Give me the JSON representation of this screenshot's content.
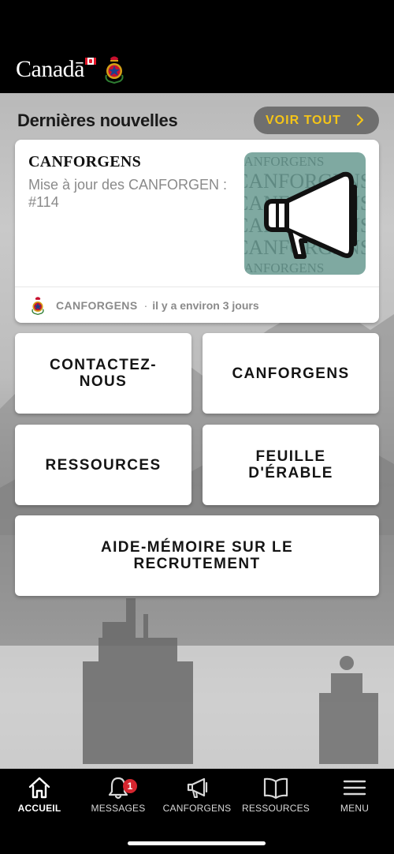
{
  "header": {
    "wordmark": "Canadā"
  },
  "news": {
    "section_title": "Dernières nouvelles",
    "see_all_label": "VOIR TOUT",
    "item": {
      "title": "CANFORGENS",
      "subtitle": "Mise à jour des CANFORGEN : #114",
      "thumbnail_text": "CANFORGENS",
      "source": "CANFORGENS",
      "separator": "·",
      "time": "il y a environ 3 jours"
    }
  },
  "tiles": {
    "contact": "CONTACTEZ-NOUS",
    "canforgens": "CANFORGENS",
    "resources": "RESSOURCES",
    "maple_leaf": "FEUILLE D'ÉRABLE",
    "recruiting": "AIDE-MÉMOIRE SUR LE RECRUTEMENT"
  },
  "tabbar": {
    "home": "ACCUEIL",
    "messages": "MESSAGES",
    "messages_badge": "1",
    "canforgens": "CANFORGENS",
    "resources": "RESSOURCES",
    "menu": "MENU"
  },
  "colors": {
    "header_bg": "#000000",
    "accent_yellow": "#f5c518",
    "badge_red": "#d6262f",
    "thumbnail_teal": "#7fa9a1"
  },
  "icons": {
    "home": "home-icon",
    "messages": "bell-icon",
    "canforgens": "megaphone-icon",
    "resources": "book-icon",
    "menu": "hamburger-icon",
    "see_all": "chevron-right-icon"
  }
}
